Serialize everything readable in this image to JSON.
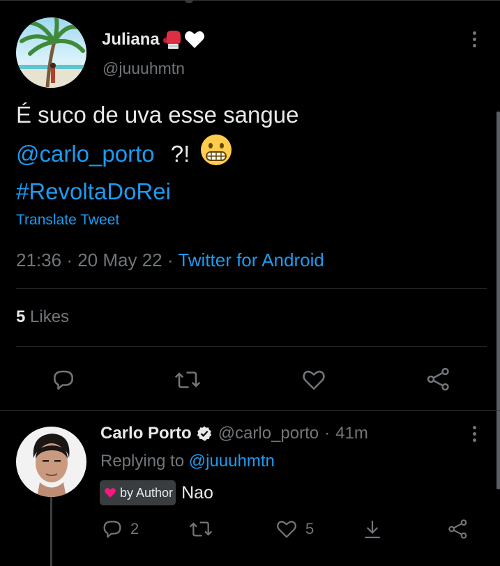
{
  "tweet": {
    "author_name": "Juliana",
    "author_emojis": "🥊🤍",
    "author_handle": "@juuuhmtn",
    "text_line1": "É suco de uva esse sangue",
    "mention": "@carlo_porto",
    "punct": "?!",
    "emoji": "grimacing-face",
    "hashtag": "#RevoltaDoRei",
    "translate_label": "Translate Tweet",
    "time": "21:36",
    "date": "20 May 22",
    "sep": "·",
    "source": "Twitter for Android",
    "likes_count": "5",
    "likes_label": "Likes"
  },
  "reply": {
    "author_name": "Carlo Porto",
    "author_handle": "@carlo_porto",
    "sep": "·",
    "age": "41m",
    "replying_prefix": "Replying to",
    "replying_to": "@juuuhmtn",
    "badge_label": "by Author",
    "text": "Nao",
    "reply_count": "2",
    "like_count": "5"
  },
  "colors": {
    "background": "#000000",
    "accent": "#1d9bf0",
    "muted": "#71767b",
    "text": "#e7e9ea",
    "badge_heart": "#f91880"
  }
}
